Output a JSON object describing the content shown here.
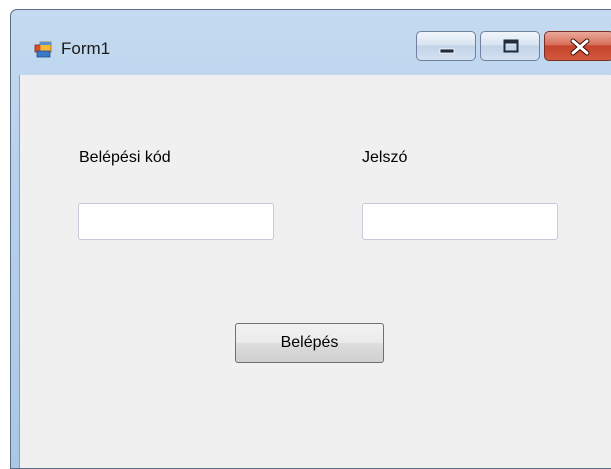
{
  "window": {
    "title": "Form1",
    "icon": "winforms-app-icon",
    "controls": {
      "minimize_icon": "minimize-icon",
      "maximize_icon": "maximize-icon",
      "close_icon": "close-icon"
    }
  },
  "form": {
    "login_code_label": "Belépési kód",
    "password_label": "Jelszó",
    "login_code_value": "",
    "password_value": "",
    "login_button": "Belépés"
  },
  "colors": {
    "title_bar": "#b7d1ec",
    "client_background": "#f0f0f0",
    "close_button": "#c4442c"
  }
}
